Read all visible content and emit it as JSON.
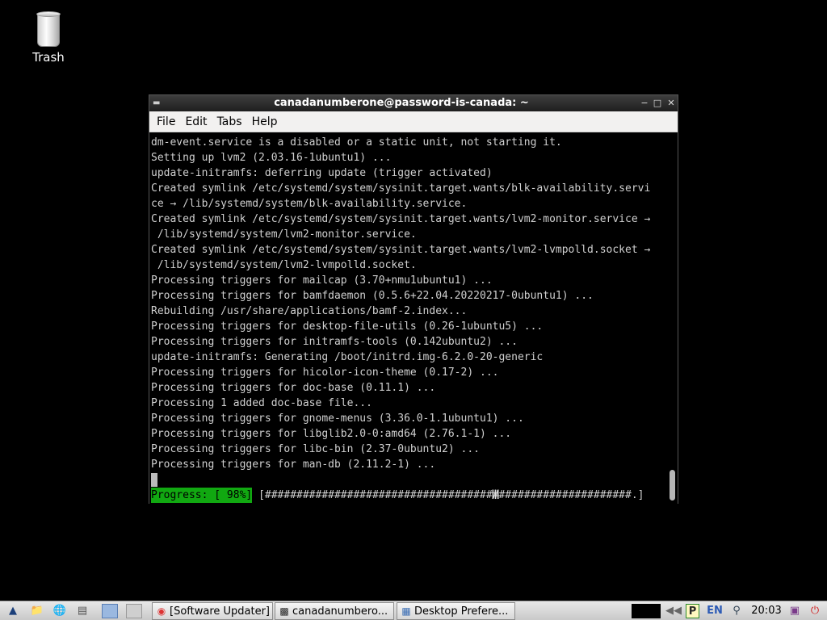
{
  "desktop": {
    "icons": [
      {
        "label": "Trash",
        "icon": "trash-icon"
      }
    ]
  },
  "terminal": {
    "title": "canadanumberone@password-is-canada: ~",
    "menu": [
      "File",
      "Edit",
      "Tabs",
      "Help"
    ],
    "lines": [
      "dm-event.service is a disabled or a static unit, not starting it.",
      "Setting up lvm2 (2.03.16-1ubuntu1) ...",
      "update-initramfs: deferring update (trigger activated)",
      "Created symlink /etc/systemd/system/sysinit.target.wants/blk-availability.servi",
      "ce → /lib/systemd/system/blk-availability.service.",
      "Created symlink /etc/systemd/system/sysinit.target.wants/lvm2-monitor.service →",
      " /lib/systemd/system/lvm2-monitor.service.",
      "Created symlink /etc/systemd/system/sysinit.target.wants/lvm2-lvmpolld.socket →",
      " /lib/systemd/system/lvm2-lvmpolld.socket.",
      "Processing triggers for mailcap (3.70+nmu1ubuntu1) ...",
      "Processing triggers for bamfdaemon (0.5.6+22.04.20220217-0ubuntu1) ...",
      "Rebuilding /usr/share/applications/bamf-2.index...",
      "Processing triggers for desktop-file-utils (0.26-1ubuntu5) ...",
      "Processing triggers for initramfs-tools (0.142ubuntu2) ...",
      "update-initramfs: Generating /boot/initrd.img-6.2.0-20-generic",
      "Processing triggers for hicolor-icon-theme (0.17-2) ...",
      "Processing triggers for doc-base (0.11.1) ...",
      "Processing 1 added doc-base file...",
      "Processing triggers for gnome-menus (3.36.0-1.1ubuntu1) ...",
      "Processing triggers for libglib2.0-0:amd64 (2.76.1-1) ...",
      "Processing triggers for libc-bin (2.37-0ubuntu2) ...",
      "Processing triggers for man-db (2.11.2-1) ..."
    ],
    "progress_label": "Progress: [ 98%]",
    "progress_bar": "[##########################################################.]",
    "progress_percent": 98
  },
  "taskbar": {
    "launchers": [
      "start-menu-icon",
      "file-manager-icon",
      "web-browser-icon",
      "show-desktop-icon",
      "workspace-1-icon",
      "workspace-2-icon"
    ],
    "tasks": [
      {
        "label": "[Software Updater]",
        "icon": "updater-icon"
      },
      {
        "label": "canadanumbero...",
        "icon": "terminal-icon"
      },
      {
        "label": "Desktop Prefere...",
        "icon": "preferences-icon"
      }
    ],
    "tray": {
      "keyboard_layout": "EN",
      "clock": "20:03"
    }
  },
  "colors": {
    "progress_green": "#11a811",
    "desktop_bg": "#000000",
    "terminal_fg": "#d0d0d0"
  }
}
